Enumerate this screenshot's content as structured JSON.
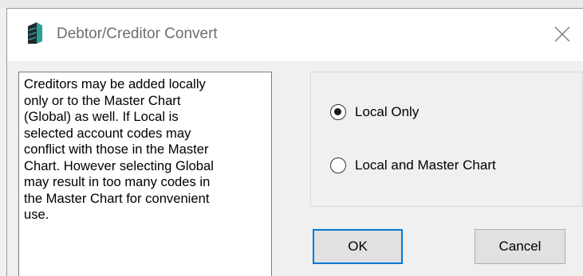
{
  "dialog": {
    "title": "Debtor/Creditor Convert",
    "icon": "database-icon",
    "close_icon": "close-icon",
    "info_text": "Creditors may be added locally\nonly or to the Master Chart\n(Global) as well. If Local is\nselected account codes may\nconflict with those in the Master\nChart. However selecting Global\nmay result in too many codes in\nthe Master Chart for convenient\nuse.",
    "options": [
      {
        "label": "Local Only",
        "selected": true
      },
      {
        "label": "Local and Master Chart",
        "selected": false
      }
    ],
    "ok_label": "OK",
    "cancel_label": "Cancel",
    "accent_color": "#0078d7"
  }
}
